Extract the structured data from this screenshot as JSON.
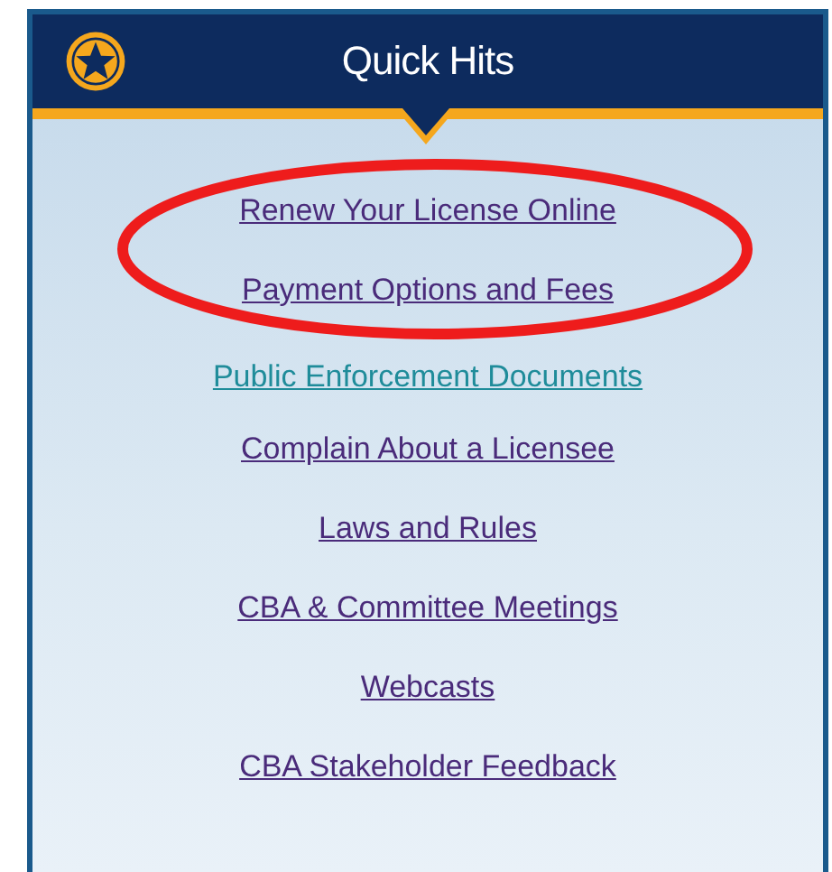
{
  "panel": {
    "title": "Quick Hits"
  },
  "links": [
    {
      "label": "Renew Your License Online",
      "visited": true
    },
    {
      "label": "Payment Options and Fees",
      "visited": true
    },
    {
      "label": "Public Enforcement Documents",
      "visited": false
    },
    {
      "label": "Complain About a Licensee",
      "visited": true
    },
    {
      "label": "Laws and Rules",
      "visited": true
    },
    {
      "label": "CBA & Committee Meetings",
      "visited": true
    },
    {
      "label": "Webcasts",
      "visited": true
    },
    {
      "label": "CBA Stakeholder Feedback",
      "visited": true
    }
  ],
  "annotation": {
    "kind": "ellipse"
  }
}
